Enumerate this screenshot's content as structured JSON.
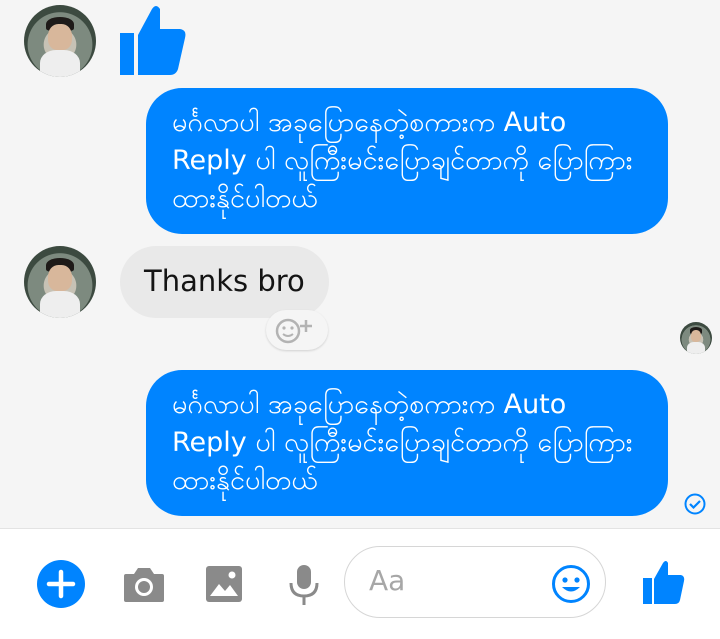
{
  "messages": [
    {
      "sender": "contact",
      "type": "like_sticker"
    },
    {
      "sender": "me",
      "text": "မင်္ဂလာပါ အခုပြောနေတဲ့စကားက Auto Reply ပါ လူကြီးမင်းပြောချင်တာကို ပြောကြားထားနိုင်ပါတယ်"
    },
    {
      "sender": "contact",
      "text": "Thanks bro"
    },
    {
      "sender": "me",
      "text": "မင်္ဂလာပါ အခုပြောနေတဲ့စကားက Auto Reply ပါ လူကြီးမင်းပြောချင်တာကို ပြောကြားထားနိုင်ပါတယ်"
    }
  ],
  "composer": {
    "placeholder": "Aa"
  },
  "colors": {
    "messenger_blue": "#0084ff",
    "incoming_bubble": "#e9e9e9",
    "background": "#f5f5f5"
  },
  "icons": [
    "like-icon",
    "add-icon",
    "camera-icon",
    "image-icon",
    "microphone-icon",
    "emoji-icon",
    "reaction-icon",
    "read-receipt-icon"
  ]
}
